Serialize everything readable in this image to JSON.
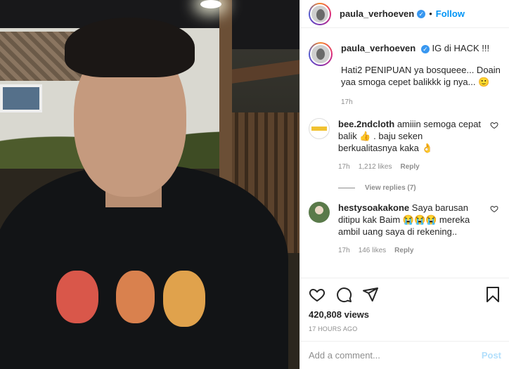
{
  "post": {
    "username": "paula_verhoeven",
    "follow_label": "Follow",
    "dot": "•",
    "caption_title": "IG di HACK !!!",
    "caption_text": "Hati2 PENIPUAN ya bosqueee... Doain yaa smoga cepet balikkk ig nya... 🙂",
    "caption_time": "17h"
  },
  "comments": [
    {
      "username": "bee.2ndcloth",
      "text": "amiiin semoga cepat balik 👍 . baju seken berkualitasnya kaka 👌",
      "time": "17h",
      "likes": "1,212 likes",
      "reply": "Reply",
      "view_replies": "View replies (7)"
    },
    {
      "username": "hestysoakakone",
      "text": "Saya barusan ditipu kak Baim 😭😭😭 mereka ambil uang saya di rekening..",
      "time": "17h",
      "likes": "146 likes",
      "reply": "Reply"
    }
  ],
  "stats": {
    "views": "420,808 views",
    "ago": "17 HOURS AGO"
  },
  "comment_box": {
    "placeholder": "Add a comment...",
    "post_label": "Post"
  },
  "colors": {
    "accent": "#0095f6",
    "muted": "#8e8e8e",
    "verified": "#3897f0"
  }
}
